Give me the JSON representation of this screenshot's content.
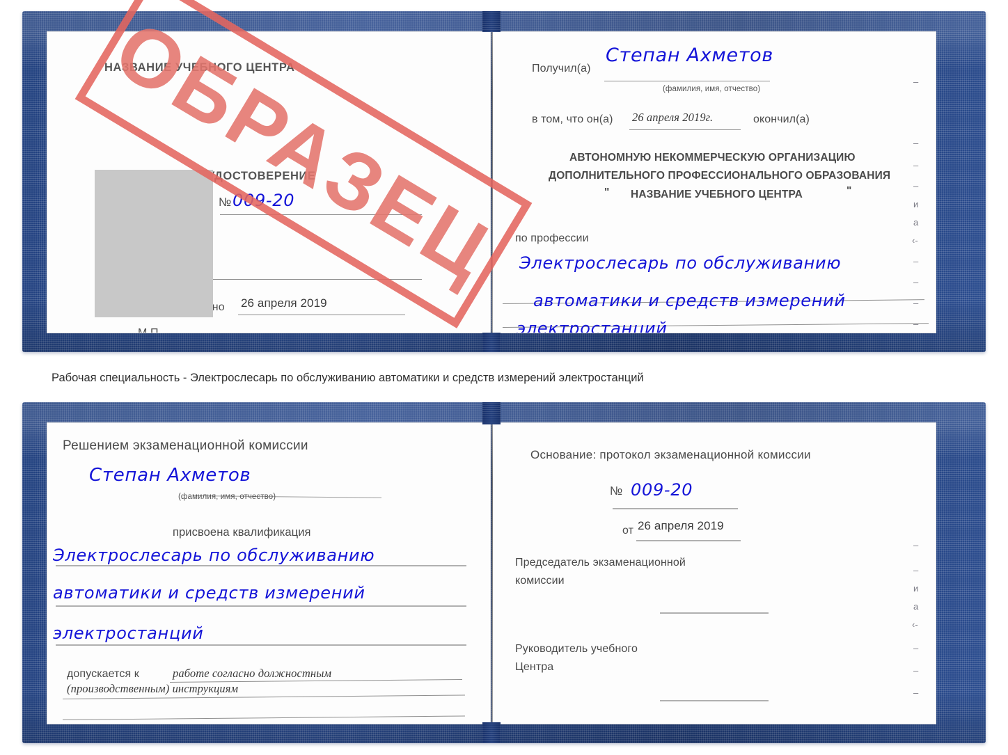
{
  "document_title": "Удостоверение — образец",
  "colors": {
    "cover_blue": "#22417f",
    "stamp_red": "#e4665f",
    "handwriting_blue": "#1414d8",
    "photo_placeholder_grey": "#c8c8c8",
    "body_text_grey": "#4a4a4a"
  },
  "stamp": {
    "text": "ОБРАЗЕЦ"
  },
  "certificate_top": {
    "left_page": {
      "center_name": "НАЗВАНИЕ УЧЕБНОГО ЦЕНТРА",
      "title": "УДОСТОВЕРЕНИЕ",
      "number_label": "№",
      "number_value": "009-20",
      "issued_label": "Выдано",
      "issued_date": "26 апреля 2019",
      "seal_label": "М.П."
    },
    "right_page": {
      "received_label": "Получил(а)",
      "received_name": "Степан Ахметов",
      "name_hint": "(фамилия, имя, отчество)",
      "in_that_label": "в том, что он(а)",
      "completion_date": "26 апреля 2019г.",
      "finished_label": "окончил(а)",
      "organization_line1": "АВТОНОМНУЮ НЕКОММЕРЧЕСКУЮ ОРГАНИЗАЦИЮ",
      "organization_line2": "ДОПОЛНИТЕЛЬНОГО ПРОФЕССИОНАЛЬНОГО ОБРАЗОВАНИЯ",
      "organization_quote_open": "\"",
      "organization_line3": "НАЗВАНИЕ УЧЕБНОГО ЦЕНТРА",
      "organization_quote_close": "\"",
      "profession_label": "по профессии",
      "profession_line1": "Электрослесарь по обслуживанию",
      "profession_line2": "автоматики и средств измерений",
      "profession_line3": "электростанций",
      "edge_marks": [
        "–",
        "–",
        "–",
        "и",
        "а",
        "‹-",
        "–",
        "–",
        "–",
        "–"
      ]
    }
  },
  "caption": "Рабочая специальность - Электрослесарь по обслуживанию автоматики и средств измерений электростанций",
  "certificate_bottom": {
    "left_page": {
      "decision_title": "Решением экзаменационной комиссии",
      "name": "Степан Ахметов",
      "name_hint": "(фамилия, имя, отчество)",
      "qualification_label": "присвоена квалификация",
      "qualification_line1": "Электрослесарь по обслуживанию",
      "qualification_line2": "автоматики и средств измерений",
      "qualification_line3": "электростанций",
      "allowed_label": "допускается к",
      "allowed_text_line1": "работе согласно должностным",
      "allowed_text_line2": "(производственным) инструкциям"
    },
    "right_page": {
      "basis_label": "Основание: протокол экзаменационной комиссии",
      "protocol_number_label": "№",
      "protocol_number_value": "009-20",
      "protocol_date_label": "от",
      "protocol_date_value": "26 апреля 2019",
      "chairman_line1": "Председатель экзаменационной",
      "chairman_line2": "комиссии",
      "head_line1": "Руководитель учебного",
      "head_line2": "Центра",
      "edge_marks": [
        "–",
        "–",
        "и",
        "а",
        "‹-",
        "–",
        "–",
        "–"
      ]
    }
  }
}
